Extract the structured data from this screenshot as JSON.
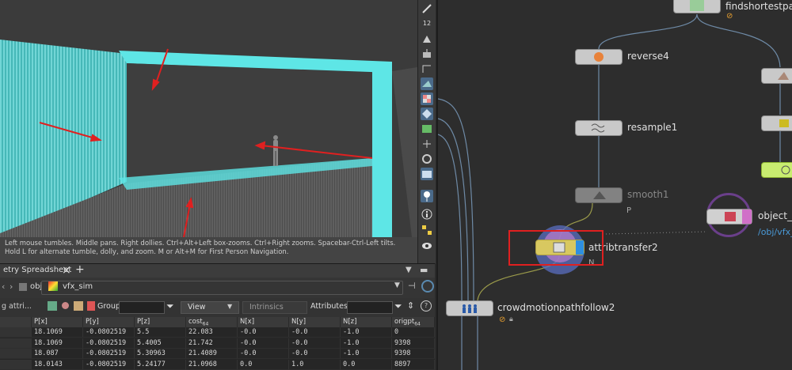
{
  "viewport": {
    "hint": "Left mouse tumbles. Middle pans. Right dollies. Ctrl+Alt+Left box-zooms. Ctrl+Right zooms. Spacebar-Ctrl-Left tilts. Hold L for alternate tumble, dolly, and zoom. M or Alt+M for First Person Navigation.",
    "toolbar_badge": "12"
  },
  "spreadsheet": {
    "tab_label": "etry Spreadsheet",
    "path_obj": "obj",
    "path_node": "vfx_sim",
    "filter_label": "g attri...",
    "group_label": "Group:",
    "view_label": "View",
    "intrinsics_label": "Intrinsics",
    "attributes_label": "Attributes:",
    "columns": [
      "",
      "P[x]",
      "P[y]",
      "P[z]",
      "cost",
      "N[x]",
      "N[y]",
      "N[z]",
      "origpt"
    ],
    "col_subscripts": {
      "cost": "64",
      "origpt": "64"
    },
    "rows": [
      [
        "",
        "18.1069",
        "-0.0802519",
        "5.5",
        "22.083",
        "-0.0",
        "-0.0",
        "-1.0",
        "0"
      ],
      [
        "",
        "18.1069",
        "-0.0802519",
        "5.4005",
        "21.742",
        "-0.0",
        "-0.0",
        "-1.0",
        "9398"
      ],
      [
        "",
        "18.087",
        "-0.0802519",
        "5.30963",
        "21.4089",
        "-0.0",
        "-0.0",
        "-1.0",
        "9398"
      ],
      [
        "",
        "18.0143",
        "-0.0802519",
        "5.24177",
        "21.0968",
        "0.0",
        "1.0",
        "0.0",
        "8897"
      ]
    ]
  },
  "network": {
    "nodes": {
      "findshortest": "findshortestpat",
      "reverse": "reverse4",
      "resample": "resample1",
      "smooth": "smooth1",
      "smooth_flag": "P",
      "attribtransfer": "attribtransfer2",
      "attribtransfer_flag": "N",
      "object_merge": "object_m",
      "object_merge_path": "/obj/vfx_",
      "crowd": "crowdmotionpathfollow2"
    }
  },
  "colors": {
    "accent_red": "#e02020",
    "cyan_geo": "#5ee6e6",
    "node_bg": "#c9c9c9",
    "highlight_box": "#e02020",
    "purple_ring": "#7a4aa8"
  }
}
